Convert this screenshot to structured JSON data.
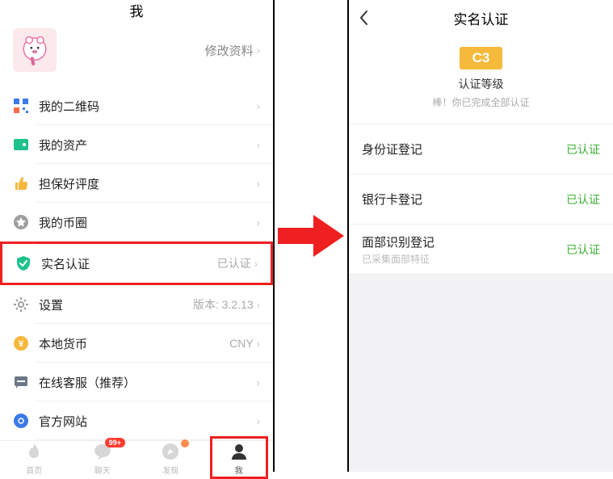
{
  "left": {
    "title": "我",
    "edit_profile": "修改资料",
    "menu": {
      "qrcode": "我的二维码",
      "assets": "我的资产",
      "rating": "担保好评度",
      "coin_circle": "我的币圈",
      "verify": "实名认证",
      "verify_status": "已认证",
      "settings": "设置",
      "settings_version": "版本: 3.2.13",
      "local_currency": "本地货币",
      "local_currency_value": "CNY",
      "support": "在线客服（推荐）",
      "website": "官方网站"
    },
    "tabs": {
      "home": "首页",
      "chat": "聊天",
      "chat_badge": "99+",
      "discover": "发现",
      "me": "我"
    }
  },
  "right": {
    "title": "实名认证",
    "hero_badge": "C3",
    "hero_title": "认证等级",
    "hero_sub": "棒！你已完成全部认证",
    "items": {
      "id": {
        "title": "身份证登记",
        "status": "已认证"
      },
      "bank": {
        "title": "银行卡登记",
        "status": "已认证"
      },
      "face": {
        "title": "面部识别登记",
        "sub": "已采集面部特征",
        "status": "已认证"
      }
    }
  }
}
